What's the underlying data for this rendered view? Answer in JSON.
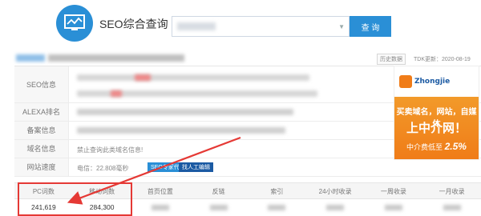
{
  "header": {
    "title": "SEO综合查询",
    "search_placeholder": "",
    "search_button": "查 询"
  },
  "toolbar": {
    "history_label": "历史数据",
    "tdk_label": "TDK更新：2020-08-19"
  },
  "info_rows": [
    {
      "label": "SEO信息"
    },
    {
      "label": "ALEXA排名"
    },
    {
      "label": "备案信息"
    },
    {
      "label": "域名信息",
      "value": "禁止查询此类域名信息!"
    },
    {
      "label": "网站速度",
      "value": "电信：22.808毫秒"
    }
  ],
  "speed_tags": {
    "tag1": "SEO专家代写",
    "tag2": "找人工编辑"
  },
  "ad": {
    "brand": "Zhongjie",
    "line1": "买卖域名，网站，自媒体",
    "line2": "上中介网！",
    "line3_prefix": "中介费低至",
    "line3_rate": "2.5%"
  },
  "stats": {
    "headers": [
      "PC词数",
      "移动词数",
      "首页位置",
      "反链",
      "索引",
      "24小时收录",
      "一周收录",
      "一月收录"
    ],
    "values": [
      "241,619",
      "284,300",
      "",
      "",
      "",
      "",
      "",
      ""
    ]
  },
  "colors": {
    "accent": "#2a8fd6",
    "highlight": "#e53935",
    "ad_orange": "#f07c18"
  }
}
